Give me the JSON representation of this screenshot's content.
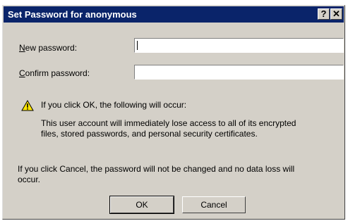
{
  "window": {
    "title": "Set Password for anonymous",
    "help_glyph": "?",
    "close_glyph": "✕"
  },
  "form": {
    "new_password_label_prefix": "N",
    "new_password_label_rest": "ew password:",
    "new_password_value": "",
    "confirm_password_label_prefix": "C",
    "confirm_password_label_rest": "onfirm password:",
    "confirm_password_value": ""
  },
  "warning": {
    "icon": "warning-triangle-icon",
    "heading": "If you click OK, the following will occur:",
    "line1": "This user account will immediately lose access to all of its encrypted",
    "line2": "files, stored passwords, and personal security certificates."
  },
  "cancel_note": {
    "line1": "If you click Cancel, the password will not be changed and no data loss will",
    "line2": "occur."
  },
  "buttons": {
    "ok": "OK",
    "cancel": "Cancel"
  },
  "colors": {
    "titlebar": "#0a246a",
    "face": "#d4d0c8",
    "warning_yellow": "#ffe600"
  }
}
